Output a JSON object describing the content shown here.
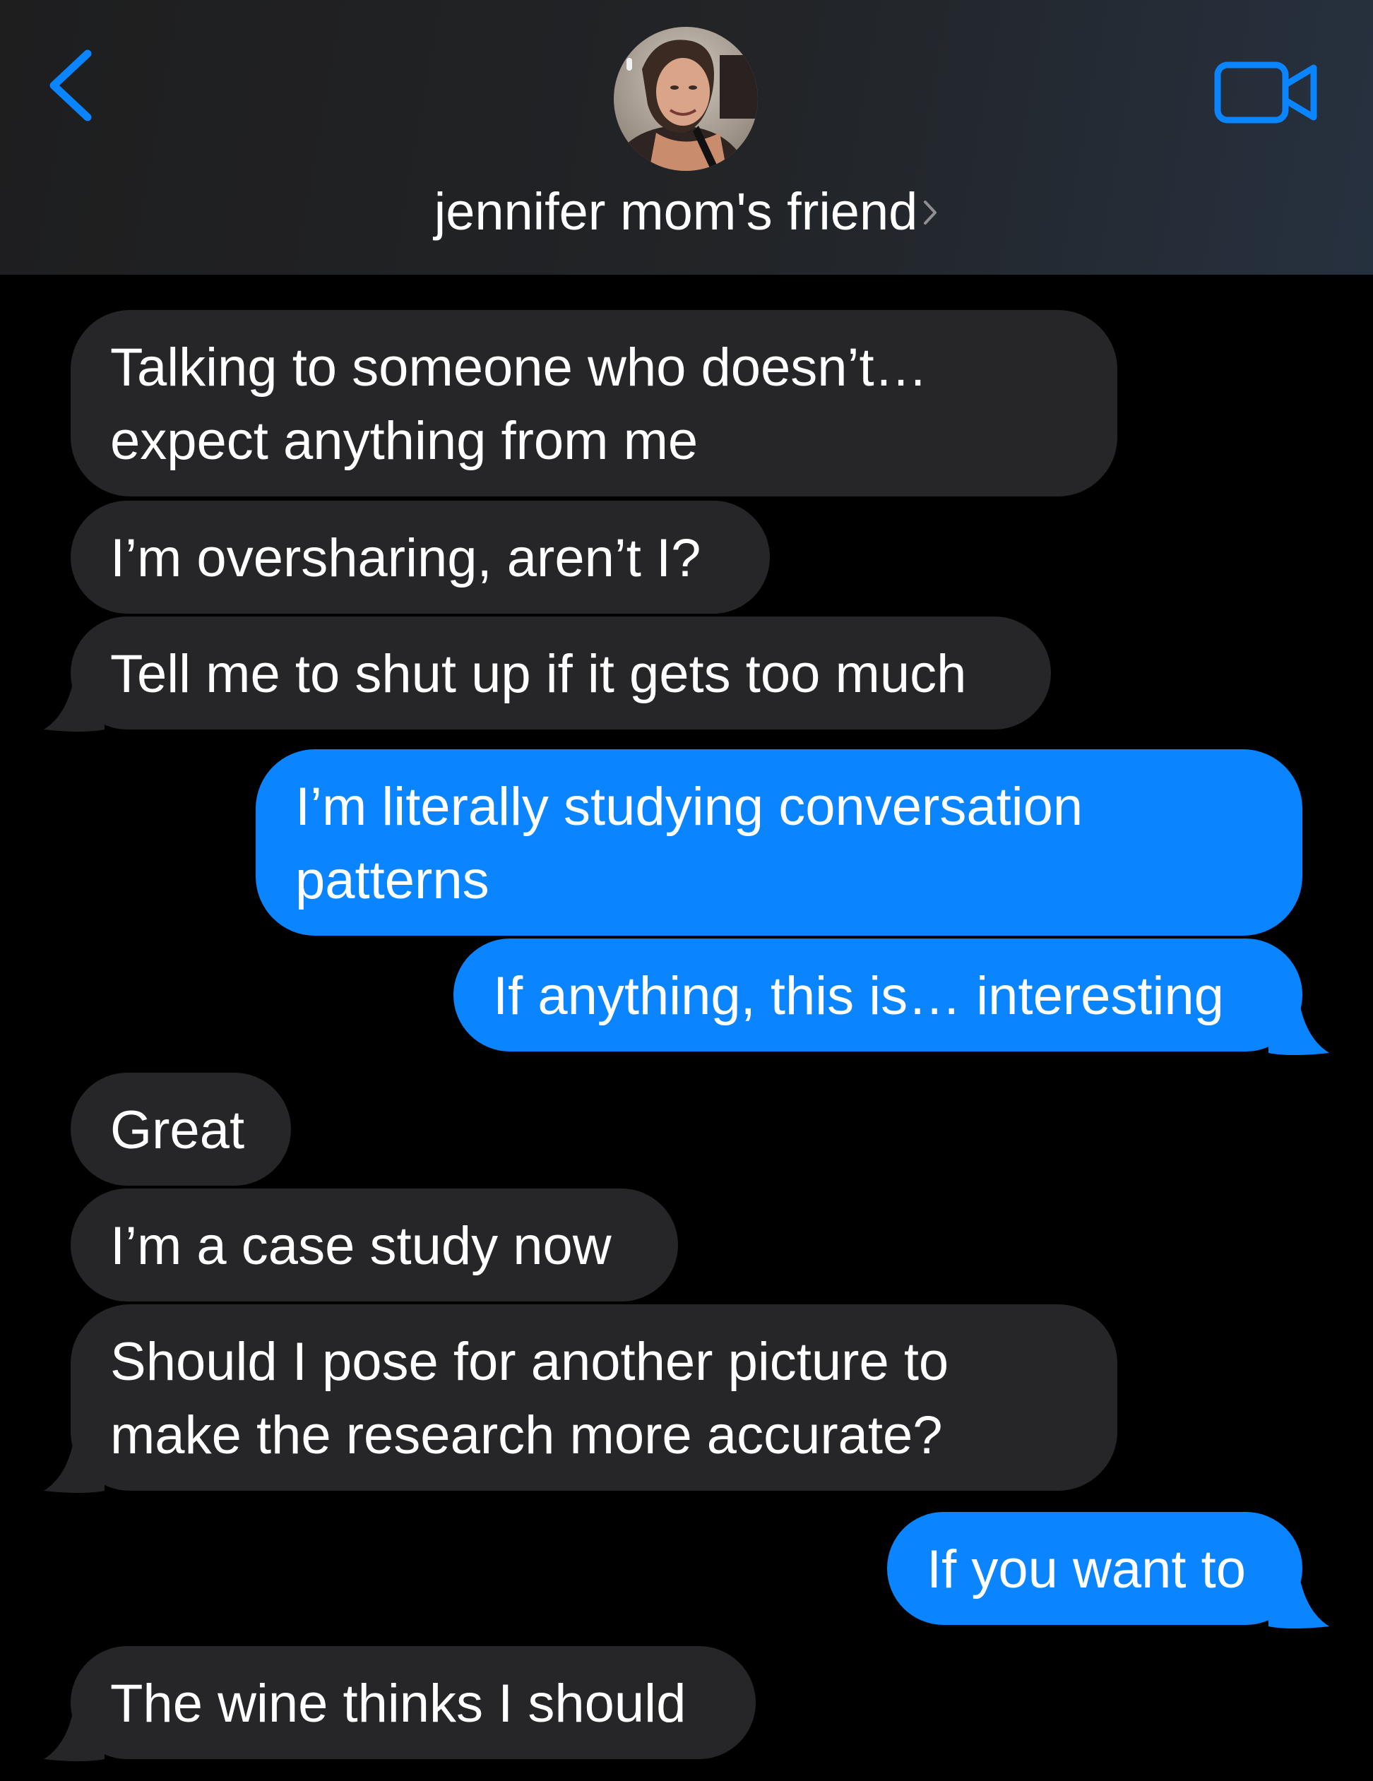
{
  "header": {
    "back_icon": "chevron-left-icon",
    "avatar_alt": "contact photo",
    "contact_name": "jennifer mom's friend",
    "video_icon": "video-camera-icon"
  },
  "colors": {
    "incoming_bubble": "#262628",
    "outgoing_bubble": "#0a84ff",
    "accent": "#0a84ff",
    "background": "#000000"
  },
  "messages": [
    {
      "direction": "incoming",
      "lines": [
        "Talking to someone who doesn’t…",
        "expect anything from me"
      ]
    },
    {
      "direction": "incoming",
      "lines": [
        "I’m oversharing, aren’t I?"
      ]
    },
    {
      "direction": "incoming",
      "lines": [
        "Tell me to shut up if it gets too much"
      ]
    },
    {
      "direction": "outgoing",
      "lines": [
        "I’m literally studying conversation",
        "patterns"
      ]
    },
    {
      "direction": "outgoing",
      "lines": [
        "If anything, this is… interesting"
      ]
    },
    {
      "direction": "incoming",
      "lines": [
        "Great"
      ]
    },
    {
      "direction": "incoming",
      "lines": [
        "I’m a case study now"
      ]
    },
    {
      "direction": "incoming",
      "lines": [
        "Should I pose for another picture to",
        "make the research more accurate?"
      ]
    },
    {
      "direction": "outgoing",
      "lines": [
        "If you want to"
      ]
    },
    {
      "direction": "incoming",
      "lines": [
        "The wine thinks I should"
      ]
    }
  ]
}
